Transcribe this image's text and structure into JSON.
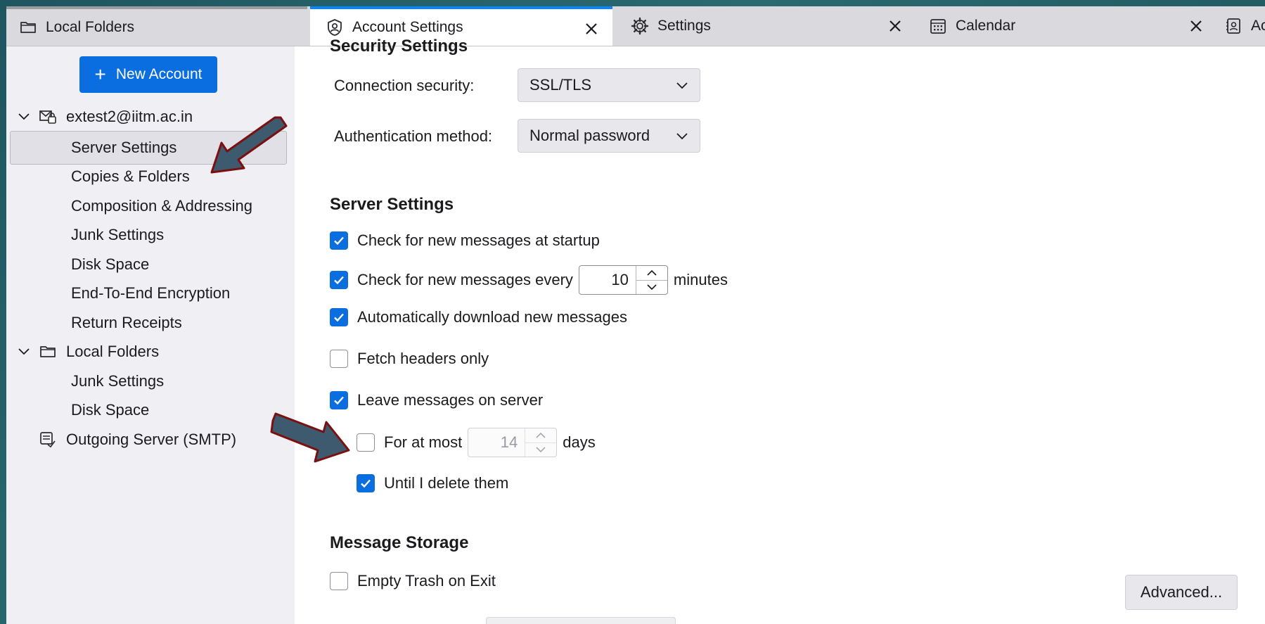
{
  "tabs": [
    {
      "label": "Local Folders",
      "icon": "folder-icon"
    },
    {
      "label": "Account Settings",
      "icon": "account-settings-icon"
    },
    {
      "label": "Settings",
      "icon": "gear-icon"
    },
    {
      "label": "Calendar",
      "icon": "calendar-icon"
    },
    {
      "label": "Ac",
      "icon": "address-book-icon"
    }
  ],
  "sidebar": {
    "new_account_label": "New Account",
    "account": {
      "label": "extest2@iitm.ac.in"
    },
    "account_items": [
      {
        "label": "Server Settings",
        "selected": true
      },
      {
        "label": "Copies & Folders"
      },
      {
        "label": "Composition & Addressing"
      },
      {
        "label": "Junk Settings"
      },
      {
        "label": "Disk Space"
      },
      {
        "label": "End-To-End Encryption"
      },
      {
        "label": "Return Receipts"
      }
    ],
    "local_folders": {
      "label": "Local Folders"
    },
    "local_items": [
      {
        "label": "Junk Settings"
      },
      {
        "label": "Disk Space"
      }
    ],
    "outgoing": {
      "label": "Outgoing Server (SMTP)"
    }
  },
  "main": {
    "security_section_title": "Security Settings",
    "connection_security_label": "Connection security:",
    "connection_security_value": "SSL/TLS",
    "auth_method_label": "Authentication method:",
    "auth_method_value": "Normal password",
    "server_section_title": "Server Settings",
    "check_startup": {
      "label": "Check for new messages at startup",
      "checked": true
    },
    "check_every": {
      "label": "Check for new messages every",
      "value": "10",
      "unit": "minutes",
      "checked": true
    },
    "auto_download": {
      "label": "Automatically download new messages",
      "checked": true
    },
    "fetch_headers": {
      "label": "Fetch headers only",
      "checked": false
    },
    "leave_on_server": {
      "label": "Leave messages on server",
      "checked": true
    },
    "for_at_most": {
      "label": "For at most",
      "value": "14",
      "unit": "days",
      "checked": false
    },
    "until_delete": {
      "label": "Until I delete them",
      "checked": true
    },
    "storage_section_title": "Message Storage",
    "empty_trash": {
      "label": "Empty Trash on Exit",
      "checked": false
    },
    "advanced_label": "Advanced..."
  },
  "colors": {
    "accent": "#0a6ee0",
    "annotation_arrow_fill": "#3d5a6e",
    "annotation_arrow_outline": "#7a1010"
  }
}
